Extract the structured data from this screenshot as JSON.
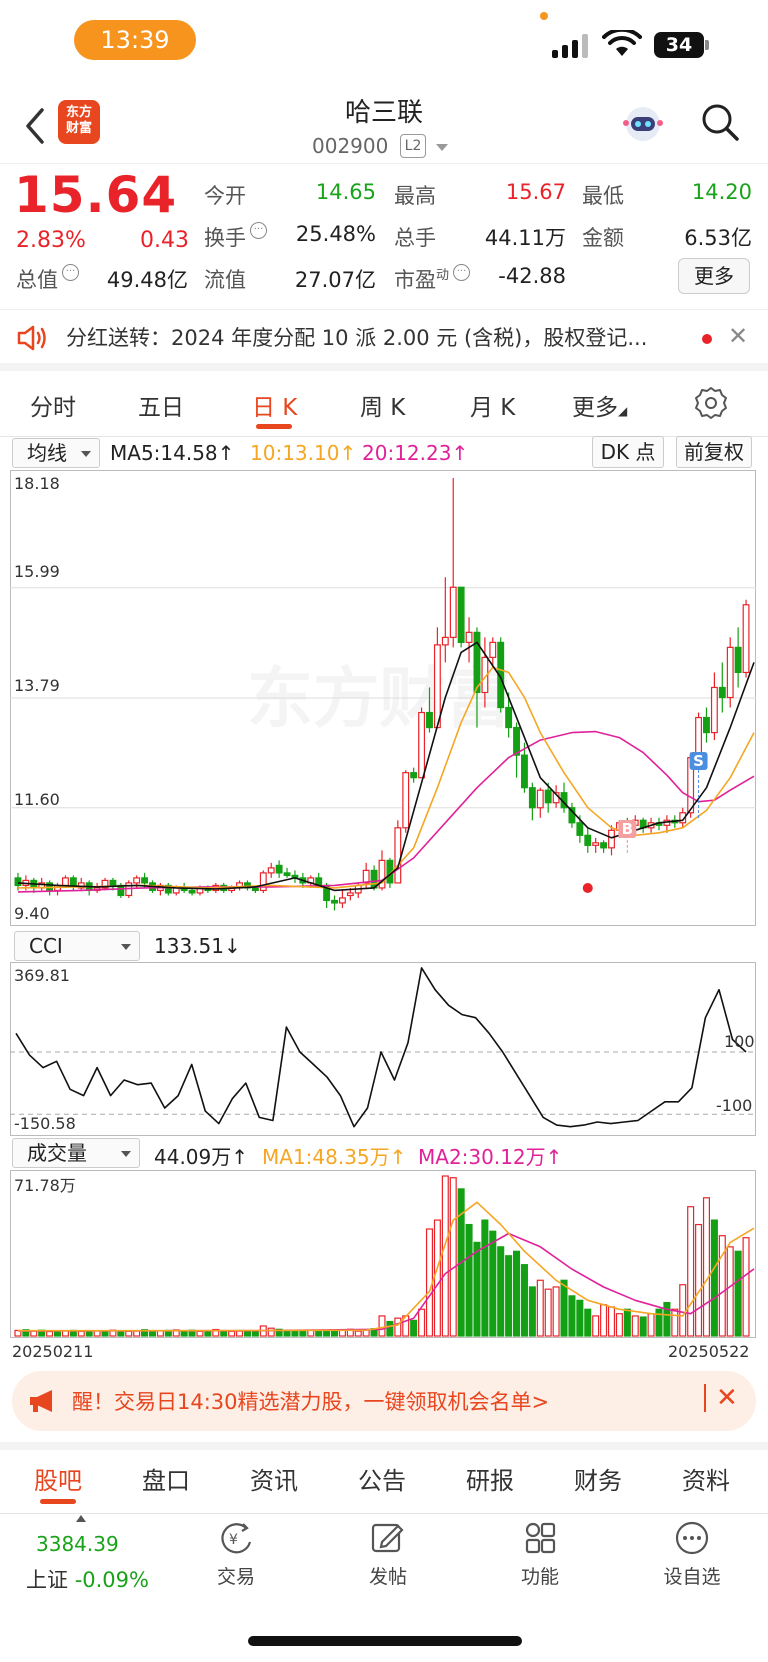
{
  "status_bar": {
    "time": "13:39",
    "battery": "34"
  },
  "header": {
    "logo_line1": "东方",
    "logo_line2": "财富",
    "title": "哈三联",
    "code": "002900",
    "level_badge": "L2"
  },
  "quote": {
    "price": "15.64",
    "change_pct": "2.83%",
    "change": "0.43",
    "rows": [
      [
        {
          "label": "今开",
          "value": "14.65",
          "color": "green"
        },
        {
          "label": "最高",
          "value": "15.67",
          "color": "red"
        },
        {
          "label": "最低",
          "value": "14.20",
          "color": "green"
        }
      ],
      [
        {
          "label": "换手",
          "value": "25.48%",
          "color": "dark"
        },
        {
          "label": "总手",
          "value": "44.11万",
          "color": "dark"
        },
        {
          "label": "金额",
          "value": "6.53亿",
          "color": "dark"
        }
      ],
      [
        {
          "label": "流值",
          "value": "27.07亿",
          "color": "dark"
        },
        {
          "label": "市盈",
          "value": "-42.88",
          "color": "dark"
        }
      ]
    ],
    "total_value_label": "总值",
    "total_value": "49.48亿",
    "pe_sup": "动",
    "more_button": "更多"
  },
  "banner": {
    "text": "分红送转：2024 年度分配 10 派 2.00 元 (含税)，股权登记..."
  },
  "period_tabs": [
    "分时",
    "五日",
    "日 K",
    "周 K",
    "月 K",
    "更多"
  ],
  "period_active": 2,
  "ma_row": {
    "selector": "均线",
    "ma5": "MA5:14.58↑",
    "ma10": "10:13.10↑",
    "ma20": "20:12.23↑",
    "dk_button": "DK 点",
    "adjust_button": "前复权"
  },
  "cci_row": {
    "selector": "CCI",
    "value": "133.51↓"
  },
  "vol_row": {
    "selector": "成交量",
    "value": "44.09万↑",
    "ma1": "MA1:48.35万↑",
    "ma2": "MA2:30.12万↑"
  },
  "colors": {
    "up": "#e8242a",
    "down": "#14a014",
    "ma5": "#111111",
    "ma10": "#f5a623",
    "ma20": "#e0219a"
  },
  "chart_data": [
    {
      "type": "candlestick",
      "title": "",
      "y_tick_labels": [
        "18.18",
        "15.99",
        "13.79",
        "11.60",
        "9.40"
      ],
      "ylim": [
        9.4,
        18.18
      ],
      "markers": [
        "S",
        "B"
      ],
      "x_start": "20250211",
      "x_end": "20250522",
      "candles": [
        [
          10.2,
          10.05,
          10.3,
          9.95
        ],
        [
          10.05,
          10.15,
          10.25,
          9.95
        ],
        [
          10.15,
          10.0,
          10.2,
          9.9
        ],
        [
          10.0,
          10.1,
          10.2,
          9.95
        ],
        [
          10.1,
          9.95,
          10.15,
          9.85
        ],
        [
          9.95,
          10.05,
          10.1,
          9.85
        ],
        [
          10.05,
          10.2,
          10.25,
          10.0
        ],
        [
          10.2,
          10.05,
          10.25,
          9.95
        ],
        [
          10.0,
          10.1,
          10.2,
          9.95
        ],
        [
          10.1,
          9.95,
          10.15,
          9.85
        ],
        [
          9.95,
          10.0,
          10.1,
          9.9
        ],
        [
          10.0,
          10.15,
          10.2,
          9.95
        ],
        [
          10.15,
          10.05,
          10.2,
          9.95
        ],
        [
          10.05,
          9.85,
          10.1,
          9.8
        ],
        [
          9.85,
          10.1,
          10.15,
          9.8
        ],
        [
          10.1,
          10.2,
          10.25,
          10.0
        ],
        [
          10.2,
          10.1,
          10.3,
          10.0
        ],
        [
          10.1,
          9.95,
          10.15,
          9.9
        ],
        [
          9.95,
          10.05,
          10.1,
          9.85
        ],
        [
          10.05,
          9.9,
          10.1,
          9.85
        ],
        [
          9.9,
          10.0,
          10.05,
          9.85
        ],
        [
          10.0,
          9.95,
          10.1,
          9.9
        ],
        [
          9.95,
          9.9,
          10.0,
          9.85
        ],
        [
          9.9,
          10.0,
          10.05,
          9.85
        ],
        [
          10.0,
          9.95,
          10.05,
          9.9
        ],
        [
          9.95,
          10.05,
          10.1,
          9.9
        ],
        [
          10.05,
          9.95,
          10.1,
          9.9
        ],
        [
          9.95,
          10.0,
          10.05,
          9.9
        ],
        [
          10.0,
          10.1,
          10.15,
          9.95
        ],
        [
          10.1,
          10.0,
          10.15,
          9.95
        ],
        [
          10.0,
          9.95,
          10.05,
          9.9
        ],
        [
          9.95,
          10.3,
          10.35,
          9.9
        ],
        [
          10.3,
          10.4,
          10.5,
          10.2
        ],
        [
          10.45,
          10.3,
          10.55,
          10.2
        ],
        [
          10.3,
          10.25,
          10.4,
          10.2
        ],
        [
          10.25,
          10.2,
          10.35,
          10.1
        ],
        [
          10.2,
          10.1,
          10.3,
          10.0
        ],
        [
          10.1,
          10.2,
          10.25,
          10.0
        ],
        [
          10.2,
          10.05,
          10.3,
          10.0
        ],
        [
          10.05,
          9.75,
          10.1,
          9.6
        ],
        [
          9.75,
          9.7,
          9.85,
          9.55
        ],
        [
          9.7,
          9.8,
          9.95,
          9.6
        ],
        [
          9.85,
          9.9,
          10.0,
          9.75
        ],
        [
          9.9,
          10.05,
          10.1,
          9.8
        ],
        [
          10.1,
          10.35,
          10.5,
          10.0
        ],
        [
          10.35,
          10.0,
          10.45,
          9.95
        ],
        [
          10.0,
          10.55,
          10.75,
          9.95
        ],
        [
          10.55,
          10.1,
          10.6,
          10.0
        ],
        [
          10.1,
          11.2,
          11.35,
          10.1
        ],
        [
          11.2,
          12.3,
          12.35,
          11.1
        ],
        [
          12.3,
          12.2,
          12.4,
          12.1
        ],
        [
          12.2,
          13.5,
          13.6,
          12.2
        ],
        [
          13.5,
          13.2,
          14.0,
          13.1
        ],
        [
          13.2,
          14.85,
          15.2,
          13.2
        ],
        [
          14.85,
          15.0,
          16.2,
          14.5
        ],
        [
          15.0,
          16.0,
          18.18,
          14.8
        ],
        [
          16.0,
          14.9,
          15.7,
          14.8
        ],
        [
          14.9,
          15.1,
          15.4,
          14.5
        ],
        [
          15.1,
          13.9,
          15.2,
          13.2
        ],
        [
          13.9,
          14.6,
          15.0,
          13.6
        ],
        [
          14.6,
          14.9,
          15.0,
          14.4
        ],
        [
          14.9,
          13.6,
          15.0,
          13.5
        ],
        [
          13.6,
          13.2,
          13.9,
          13.0
        ],
        [
          13.2,
          12.65,
          13.3,
          12.2
        ],
        [
          12.65,
          12.0,
          12.9,
          11.9
        ],
        [
          12.0,
          11.6,
          12.1,
          11.35
        ],
        [
          11.6,
          11.95,
          12.0,
          11.4
        ],
        [
          11.95,
          11.7,
          12.1,
          11.5
        ],
        [
          11.7,
          11.9,
          12.05,
          11.6
        ],
        [
          11.9,
          11.6,
          12.1,
          11.5
        ],
        [
          11.6,
          11.3,
          11.7,
          11.2
        ],
        [
          11.3,
          11.05,
          11.45,
          10.9
        ],
        [
          11.05,
          10.85,
          11.2,
          10.7
        ],
        [
          10.85,
          10.9,
          11.0,
          10.7
        ],
        [
          10.9,
          10.8,
          10.95,
          10.7
        ],
        [
          10.8,
          11.15,
          11.25,
          10.65
        ],
        [
          11.15,
          11.3,
          11.35,
          11.0
        ],
        [
          11.3,
          11.25,
          11.4,
          11.1
        ],
        [
          11.25,
          11.35,
          11.45,
          11.1
        ],
        [
          11.35,
          11.2,
          11.4,
          11.1
        ],
        [
          11.2,
          11.3,
          11.4,
          11.1
        ],
        [
          11.3,
          11.25,
          11.4,
          11.15
        ],
        [
          11.25,
          11.35,
          11.45,
          11.1
        ],
        [
          11.35,
          11.3,
          11.45,
          11.2
        ],
        [
          11.3,
          11.5,
          11.6,
          11.2
        ],
        [
          11.5,
          12.6,
          12.7,
          11.4
        ],
        [
          12.6,
          13.4,
          13.5,
          12.5
        ],
        [
          13.4,
          13.1,
          13.6,
          12.9
        ],
        [
          13.1,
          14.0,
          14.3,
          12.95
        ],
        [
          14.0,
          13.8,
          14.5,
          13.5
        ],
        [
          13.8,
          14.8,
          15.0,
          13.6
        ],
        [
          14.8,
          14.3,
          15.2,
          14.0
        ],
        [
          14.3,
          15.65,
          15.75,
          14.2
        ]
      ],
      "ma5": [
        [
          0,
          10.1
        ],
        [
          5,
          10.05
        ],
        [
          10,
          10.02
        ],
        [
          15,
          10.05
        ],
        [
          20,
          10.0
        ],
        [
          25,
          9.98
        ],
        [
          30,
          10.02
        ],
        [
          35,
          10.2
        ],
        [
          40,
          9.95
        ],
        [
          45,
          10.0
        ],
        [
          48,
          10.4
        ],
        [
          51,
          12.1
        ],
        [
          54,
          13.8
        ],
        [
          56,
          14.7
        ],
        [
          58,
          14.9
        ],
        [
          61,
          14.2
        ],
        [
          64,
          13.0
        ],
        [
          66,
          12.2
        ],
        [
          69,
          11.7
        ],
        [
          72,
          11.2
        ],
        [
          75,
          11.0
        ],
        [
          78,
          11.15
        ],
        [
          81,
          11.3
        ],
        [
          84,
          11.35
        ],
        [
          87,
          12.0
        ],
        [
          90,
          13.2
        ],
        [
          93,
          14.5
        ]
      ],
      "ma10": [
        [
          0,
          10.0
        ],
        [
          8,
          10.02
        ],
        [
          16,
          10.05
        ],
        [
          24,
          10.0
        ],
        [
          32,
          10.05
        ],
        [
          40,
          10.0
        ],
        [
          46,
          10.1
        ],
        [
          50,
          10.8
        ],
        [
          53,
          12.0
        ],
        [
          56,
          13.3
        ],
        [
          58,
          14.0
        ],
        [
          60,
          14.4
        ],
        [
          62,
          14.3
        ],
        [
          64,
          13.8
        ],
        [
          66,
          13.1
        ],
        [
          69,
          12.3
        ],
        [
          72,
          11.6
        ],
        [
          75,
          11.2
        ],
        [
          78,
          11.05
        ],
        [
          81,
          11.1
        ],
        [
          84,
          11.2
        ],
        [
          87,
          11.55
        ],
        [
          90,
          12.2
        ],
        [
          93,
          13.1
        ]
      ],
      "ma20": [
        [
          0,
          9.92
        ],
        [
          8,
          9.95
        ],
        [
          16,
          10.0
        ],
        [
          24,
          10.02
        ],
        [
          32,
          10.02
        ],
        [
          40,
          10.05
        ],
        [
          46,
          10.15
        ],
        [
          50,
          10.6
        ],
        [
          54,
          11.3
        ],
        [
          58,
          12.0
        ],
        [
          62,
          12.6
        ],
        [
          66,
          12.95
        ],
        [
          70,
          13.1
        ],
        [
          73,
          13.12
        ],
        [
          76,
          13.0
        ],
        [
          79,
          12.7
        ],
        [
          82,
          12.25
        ],
        [
          84,
          11.9
        ],
        [
          86,
          11.72
        ],
        [
          88,
          11.75
        ],
        [
          90,
          11.95
        ],
        [
          93,
          12.23
        ]
      ]
    },
    {
      "type": "line",
      "title": "CCI",
      "y_tick_labels": [
        "369.81",
        "-150.58",
        "100",
        "-100"
      ],
      "ylim": [
        -150.58,
        369.81
      ],
      "values": [
        160,
        90,
        50,
        70,
        -20,
        -40,
        50,
        -40,
        10,
        -5,
        0,
        -80,
        -40,
        60,
        -90,
        -130,
        -50,
        0,
        -110,
        -120,
        180,
        100,
        60,
        20,
        -40,
        -140,
        -80,
        100,
        10,
        130,
        370,
        300,
        250,
        220,
        210,
        160,
        100,
        30,
        -40,
        -110,
        -135,
        -140,
        -135,
        -125,
        -130,
        -125,
        -120,
        -90,
        -60,
        -60,
        -15,
        210,
        300,
        140,
        100
      ]
    },
    {
      "type": "bar",
      "title": "成交量",
      "y_tick_labels": [
        "71.78万"
      ],
      "ylim": [
        0,
        71.78
      ],
      "x_tick_labels": [
        "20250211",
        "20250522"
      ],
      "values": [
        2.5,
        2.8,
        2.2,
        2.6,
        2.0,
        2.4,
        2.3,
        2.5,
        2.1,
        2.2,
        2.4,
        2.0,
        2.6,
        2.3,
        2.1,
        2.2,
        2.8,
        2.4,
        2.3,
        2.5,
        2.7,
        2.2,
        2.6,
        2.1,
        2.3,
        2.9,
        2.4,
        2.1,
        2.2,
        2.3,
        2.4,
        4.5,
        3.5,
        3.0,
        2.5,
        2.6,
        2.2,
        2.6,
        2.3,
        2.4,
        2.5,
        2.7,
        3.0,
        2.2,
        2.6,
        3.3,
        9.0,
        6.5,
        8.0,
        9.0,
        7.0,
        12.0,
        48.0,
        52.0,
        71.78,
        71.0,
        66.0,
        50.0,
        42.0,
        52.0,
        47.0,
        40.0,
        36.0,
        38.0,
        32.0,
        22.0,
        25.0,
        21.0,
        22.0,
        25.0,
        18.0,
        16.0,
        12.0,
        9.0,
        14.0,
        13.0,
        10.0,
        12.0,
        9.0,
        8.5,
        10.0,
        12.0,
        15.0,
        12.0,
        23.0,
        58.0,
        50.0,
        62.0,
        52.0,
        45.0,
        40.0,
        38.0,
        44.09
      ],
      "ups": [
        1,
        0,
        1,
        0,
        1,
        0,
        1,
        0,
        1,
        0,
        1,
        0,
        1,
        0,
        1,
        1,
        0,
        0,
        1,
        0,
        1,
        0,
        0,
        1,
        0,
        1,
        0,
        1,
        1,
        0,
        0,
        1,
        1,
        0,
        0,
        0,
        0,
        1,
        0,
        0,
        0,
        1,
        1,
        1,
        1,
        0,
        1,
        0,
        1,
        1,
        0,
        1,
        1,
        1,
        1,
        1,
        0,
        0,
        0,
        0,
        0,
        0,
        0,
        0,
        0,
        0,
        1,
        1,
        1,
        0,
        0,
        0,
        0,
        1,
        1,
        1,
        1,
        0,
        1,
        0,
        1,
        0,
        0,
        1,
        1,
        1,
        1,
        1,
        0,
        1,
        1,
        0,
        1
      ],
      "ma1": [
        [
          0,
          2.4
        ],
        [
          20,
          2.4
        ],
        [
          44,
          2.6
        ],
        [
          48,
          5.0
        ],
        [
          52,
          20.0
        ],
        [
          55,
          52.0
        ],
        [
          58,
          60.0
        ],
        [
          61,
          50.0
        ],
        [
          64,
          38.0
        ],
        [
          68,
          25.0
        ],
        [
          72,
          16.0
        ],
        [
          76,
          12.0
        ],
        [
          80,
          10.0
        ],
        [
          84,
          9.0
        ],
        [
          87,
          25.0
        ],
        [
          90,
          42.0
        ],
        [
          93,
          48.35
        ]
      ],
      "ma2": [
        [
          0,
          2.3
        ],
        [
          30,
          2.4
        ],
        [
          46,
          3.0
        ],
        [
          50,
          8.0
        ],
        [
          54,
          28.0
        ],
        [
          58,
          38.0
        ],
        [
          62,
          46.0
        ],
        [
          66,
          40.0
        ],
        [
          70,
          30.0
        ],
        [
          74,
          22.0
        ],
        [
          78,
          16.0
        ],
        [
          82,
          12.0
        ],
        [
          85,
          10.0
        ],
        [
          88,
          17.0
        ],
        [
          93,
          30.12
        ]
      ]
    }
  ],
  "promo": {
    "text": "醒！交易日14:30精选潜力股，一键领取机会名单>"
  },
  "bottom_tabs": [
    "股吧",
    "盘口",
    "资讯",
    "公告",
    "研报",
    "财务",
    "资料"
  ],
  "bottom_tab_active": 0,
  "nav": {
    "index_value": "3384.39",
    "index_name": "上证",
    "index_change": "-0.09%",
    "items": [
      "交易",
      "发帖",
      "功能",
      "设自选"
    ]
  }
}
